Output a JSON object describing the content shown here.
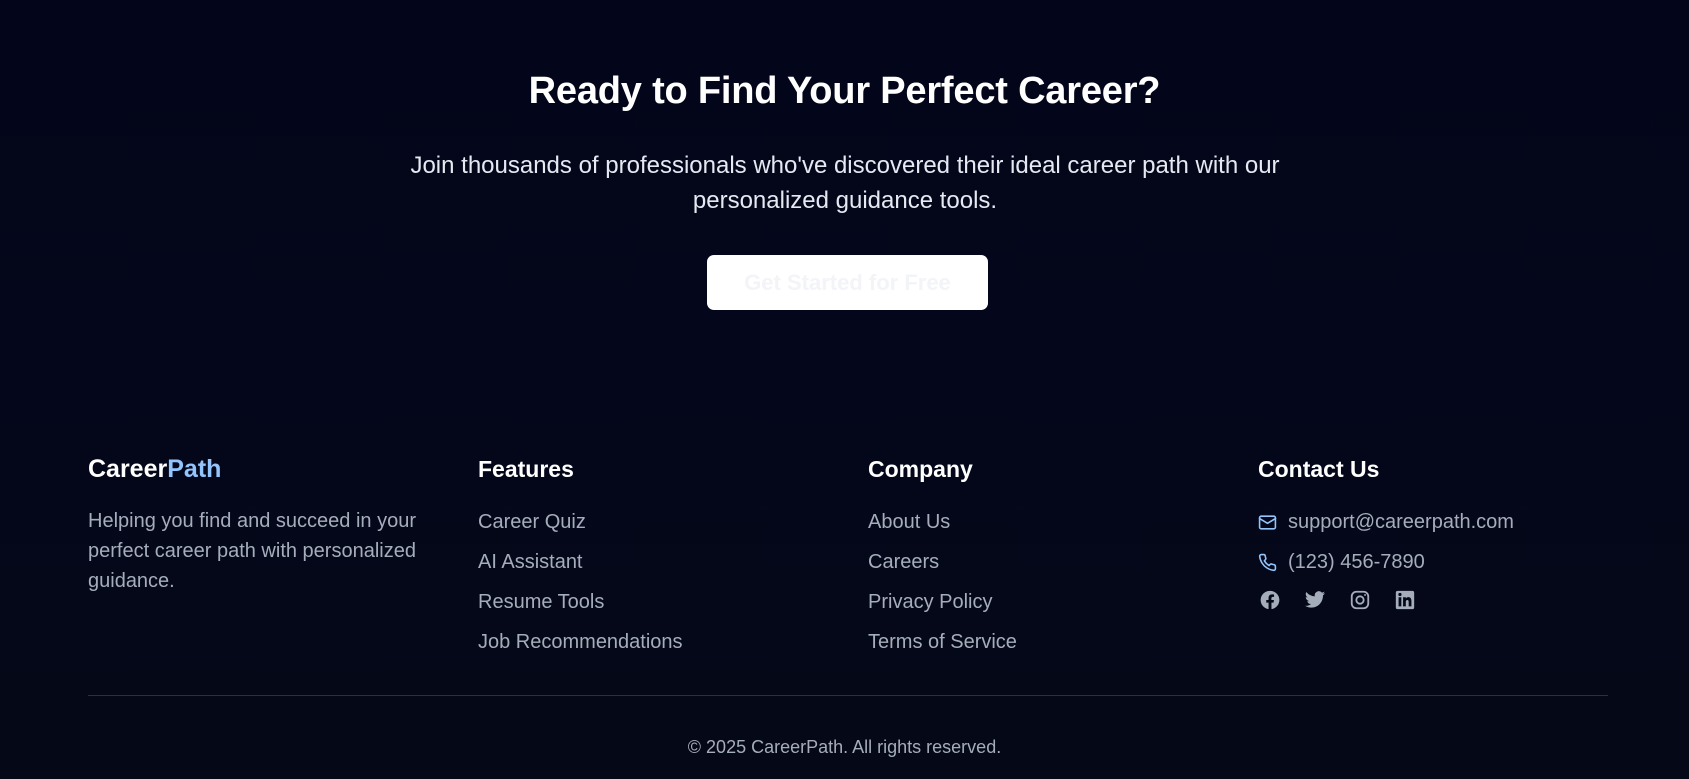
{
  "cta": {
    "title": "Ready to Find Your Perfect Career?",
    "subtitle": "Join thousands of professionals who've discovered their ideal career path with our personalized guidance tools.",
    "button_label": "Get Started for Free"
  },
  "footer": {
    "brand": {
      "part1": "Career",
      "part2": "Path",
      "description": "Helping you find and succeed in your perfect career path with personalized guidance."
    },
    "features": {
      "heading": "Features",
      "links": [
        "Career Quiz",
        "AI Assistant",
        "Resume Tools",
        "Job Recommendations"
      ]
    },
    "company": {
      "heading": "Company",
      "links": [
        "About Us",
        "Careers",
        "Privacy Policy",
        "Terms of Service"
      ]
    },
    "contact": {
      "heading": "Contact Us",
      "email": "support@careerpath.com",
      "phone": "(123) 456-7890",
      "social_icons": [
        "facebook-icon",
        "twitter-icon",
        "instagram-icon",
        "linkedin-icon"
      ]
    },
    "copyright": "© 2025 CareerPath. All rights reserved."
  },
  "colors": {
    "background": "#03061a",
    "accent": "#93c5fd",
    "muted_text": "#a5adbb",
    "button_bg": "#ffffff"
  }
}
